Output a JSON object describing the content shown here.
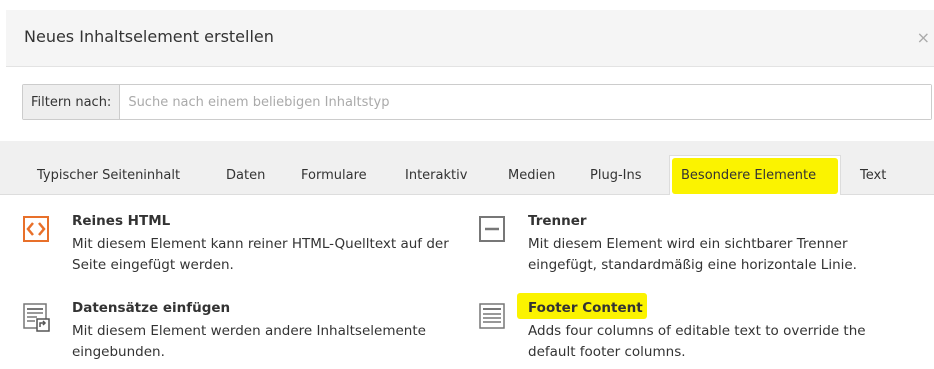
{
  "dialog": {
    "title": "Neues Inhaltselement erstellen",
    "close_symbol": "×"
  },
  "filter": {
    "label": "Filtern nach:",
    "placeholder": "Suche nach einem beliebigen Inhaltstyp",
    "value": ""
  },
  "tabs": [
    {
      "label": "Typischer Seiteninhalt",
      "active": false
    },
    {
      "label": "Daten",
      "active": false
    },
    {
      "label": "Formulare",
      "active": false
    },
    {
      "label": "Interaktiv",
      "active": false
    },
    {
      "label": "Medien",
      "active": false
    },
    {
      "label": "Plug-Ins",
      "active": false
    },
    {
      "label": "Besondere Elemente",
      "active": true
    },
    {
      "label": "Text",
      "active": false
    }
  ],
  "items": [
    {
      "title": "Reines HTML",
      "description_line1": "Mit diesem Element kann reiner HTML-Quelltext auf der",
      "description_line2": "Seite eingefügt werden.",
      "icon": "html-code-icon"
    },
    {
      "title": "Trenner",
      "description_line1": "Mit diesem Element wird ein sichtbarer Trenner",
      "description_line2": "eingefügt, standardmäßig eine horizontale Linie.",
      "icon": "divider-icon"
    },
    {
      "title": "Datensätze einfügen",
      "description_line1": "Mit diesem Element werden andere Inhaltselemente",
      "description_line2": "eingebunden.",
      "icon": "insert-records-icon"
    },
    {
      "title": "Footer Content",
      "description_line1": "Adds four columns of editable text to override the",
      "description_line2": "default footer columns.",
      "icon": "text-columns-icon"
    }
  ],
  "colors": {
    "highlight": "#fbf300",
    "html_icon_orange": "#e8702a",
    "icon_gray": "#777777"
  }
}
